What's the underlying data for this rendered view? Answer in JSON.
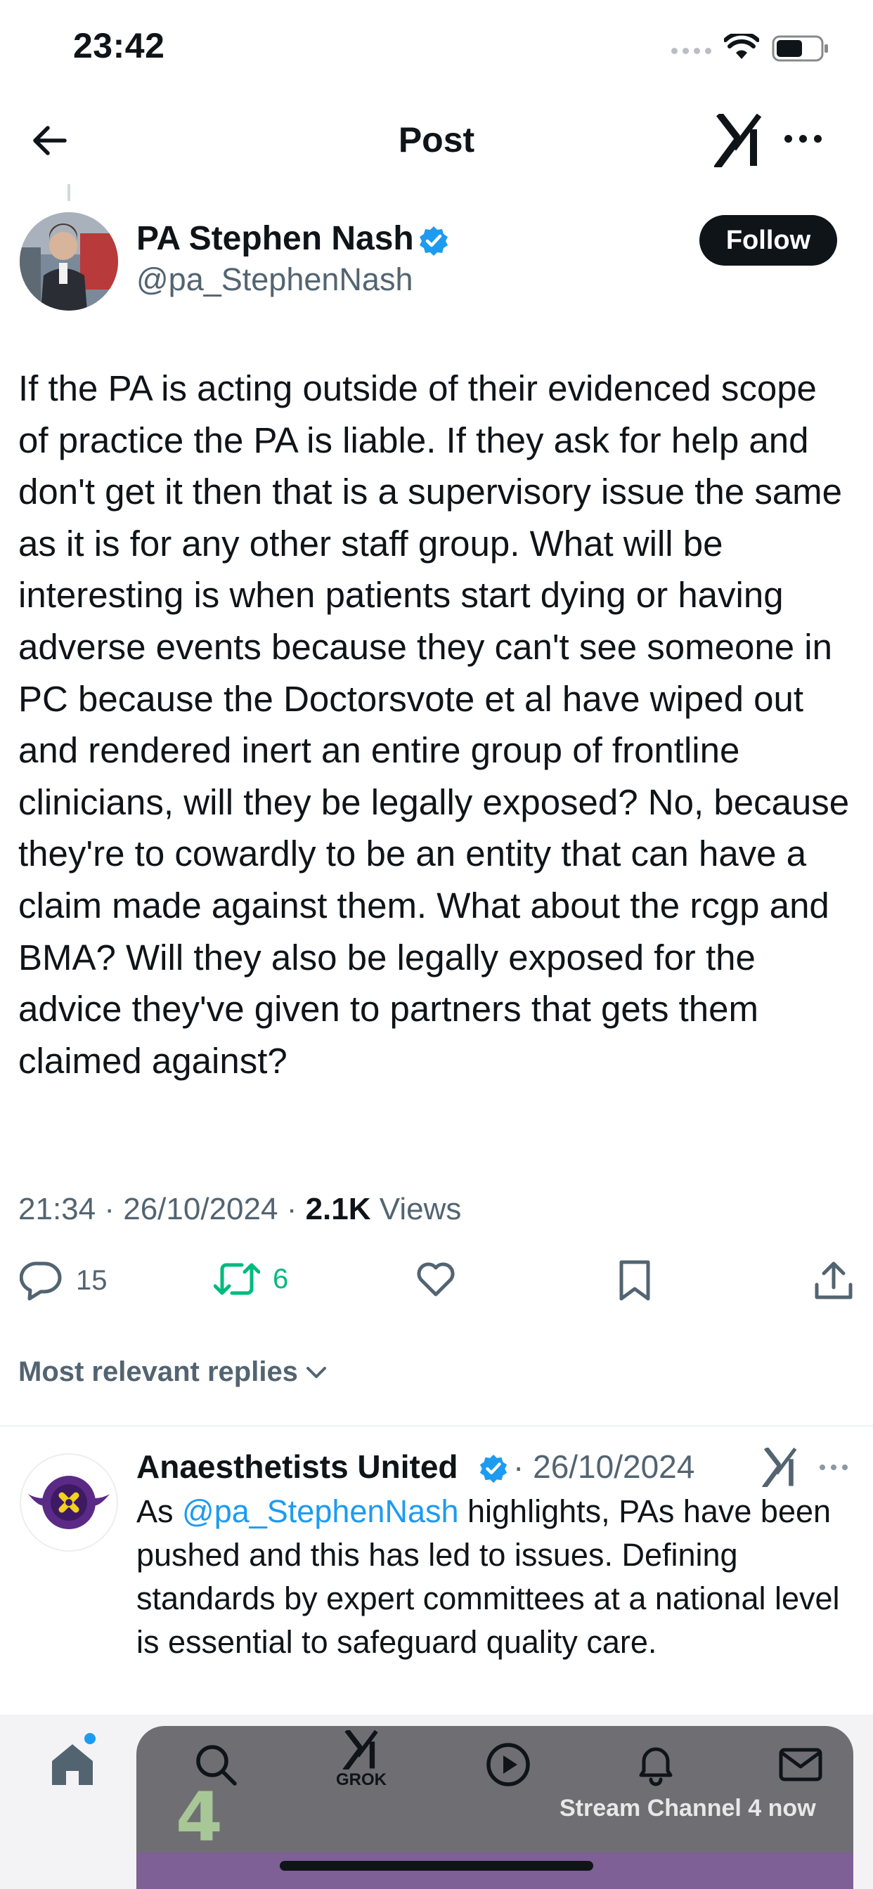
{
  "status_bar": {
    "time": "23:42"
  },
  "header": {
    "title": "Post"
  },
  "post": {
    "author_name": "PA Stephen Nash",
    "author_handle": "@pa_StephenNash",
    "follow_label": "Follow",
    "text": "If the PA is acting outside of their evidenced scope of practice the PA is liable. If they ask for help and don't get it then that is a supervisory issue the same as it is for any other staff group. What will be interesting is when patients start dying or having adverse events because they can't see someone in PC because the Doctorsvote et al have wiped out and rendered inert an entire group of frontline clinicians, will they be legally exposed? No, because they're to cowardly to be an entity that can have a claim made against them. What about the rcgp and BMA? Will they also be legally exposed for the advice they've given to partners that gets them claimed against?",
    "time": "21:34",
    "date": "26/10/2024",
    "views_count": "2.1K",
    "views_label": "Views",
    "replies_count": "15",
    "reposts_count": "6"
  },
  "replies_sort": {
    "label": "Most relevant replies"
  },
  "reply": {
    "author_name": "Anaesthetists United",
    "date": "26/10/2024",
    "text_before": "As ",
    "mention": "@pa_StephenNash",
    "text_after": " highlights, PAs have been pushed and this has led to issues. Defining standards by expert committees at a national level is essential to safeguard quality care."
  },
  "bottom_nav": {
    "grok_label": "GROK",
    "ad_text": "Stream Channel 4 now",
    "ad_logo": "4"
  },
  "colors": {
    "accent": "#1d9bf0",
    "repost": "#00ba7c",
    "muted": "#536471"
  }
}
